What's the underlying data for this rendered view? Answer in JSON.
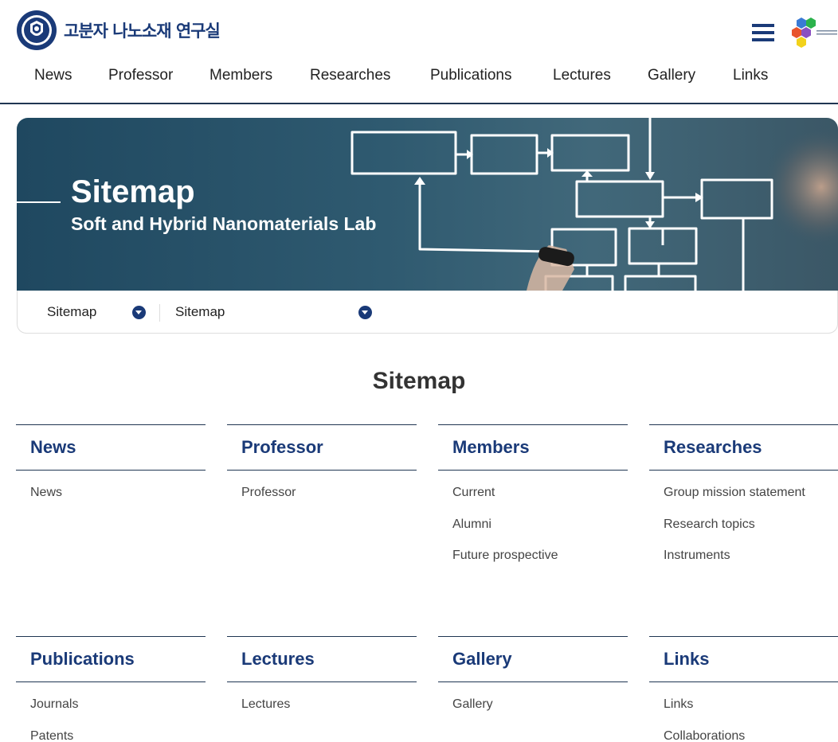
{
  "header": {
    "logo_text": "고분자 나노소재 연구실",
    "nav": [
      "News",
      "Professor",
      "Members",
      "Researches",
      "Publications",
      "Lectures",
      "Gallery",
      "Links"
    ]
  },
  "banner": {
    "title": "Sitemap",
    "subtitle": "Soft and Hybrid Nanomaterials Lab"
  },
  "breadcrumb": [
    "Sitemap",
    "Sitemap"
  ],
  "page_title": "Sitemap",
  "sitemap": [
    {
      "title": "News",
      "items": [
        "News"
      ]
    },
    {
      "title": "Professor",
      "items": [
        "Professor"
      ]
    },
    {
      "title": "Members",
      "items": [
        "Current",
        "Alumni",
        "Future prospective"
      ]
    },
    {
      "title": "Researches",
      "items": [
        "Group mission statement",
        "Research topics",
        "Instruments"
      ]
    },
    {
      "title": "Publications",
      "items": [
        "Journals",
        "Patents"
      ]
    },
    {
      "title": "Lectures",
      "items": [
        "Lectures"
      ]
    },
    {
      "title": "Gallery",
      "items": [
        "Gallery"
      ]
    },
    {
      "title": "Links",
      "items": [
        "Links",
        "Collaborations"
      ]
    }
  ],
  "colors": {
    "brand_navy": "#1a3a78",
    "rule": "#1f3552"
  },
  "icons": [
    "university-seal-icon",
    "hamburger-menu-icon",
    "lab-logo-icon",
    "chevron-down-icon"
  ]
}
